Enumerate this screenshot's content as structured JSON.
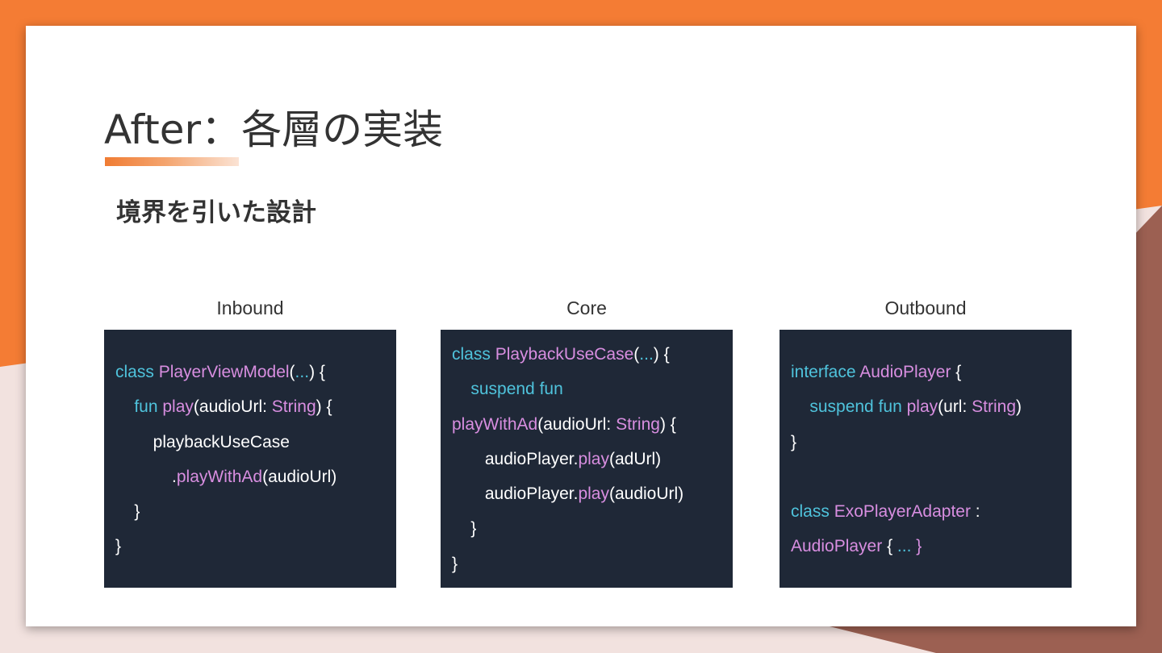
{
  "slide": {
    "title": "After：各層の実装",
    "subtitle": "境界を引いた設計"
  },
  "colors": {
    "accent": "#f07c33",
    "background_dark": "#9c6052",
    "background_light": "#f2e2df",
    "code_background": "#1f2837",
    "keyword": "#4fc3dc",
    "type_or_function": "#d88ee0",
    "plain_code": "#ffffff"
  },
  "columns": [
    {
      "label": "Inbound",
      "lines": [
        [
          {
            "t": "class ",
            "c": "k"
          },
          {
            "t": "PlayerViewModel",
            "c": "t"
          },
          {
            "t": "(",
            "c": "p"
          },
          {
            "t": "...",
            "c": "d"
          },
          {
            "t": ") {",
            "c": "p"
          }
        ],
        [
          {
            "t": "    ",
            "c": "p"
          },
          {
            "t": "fun ",
            "c": "k"
          },
          {
            "t": "play",
            "c": "t"
          },
          {
            "t": "(audioUrl: ",
            "c": "p"
          },
          {
            "t": "String",
            "c": "t"
          },
          {
            "t": ") {",
            "c": "p"
          }
        ],
        [
          {
            "t": "        playbackUseCase",
            "c": "p"
          }
        ],
        [
          {
            "t": "            .",
            "c": "p"
          },
          {
            "t": "playWithAd",
            "c": "t"
          },
          {
            "t": "(audioUrl)",
            "c": "p"
          }
        ],
        [
          {
            "t": "    }",
            "c": "p"
          }
        ],
        [
          {
            "t": "}",
            "c": "p"
          }
        ]
      ]
    },
    {
      "label": "Core",
      "lines": [
        [
          {
            "t": "class ",
            "c": "k"
          },
          {
            "t": "PlaybackUseCase",
            "c": "t"
          },
          {
            "t": "(",
            "c": "p"
          },
          {
            "t": "...",
            "c": "d"
          },
          {
            "t": ") {",
            "c": "p"
          }
        ],
        [
          {
            "t": "    ",
            "c": "p"
          },
          {
            "t": "suspend fun",
            "c": "k"
          }
        ],
        [
          {
            "t": "playWithAd",
            "c": "t"
          },
          {
            "t": "(audioUrl: ",
            "c": "p"
          },
          {
            "t": "String",
            "c": "t"
          },
          {
            "t": ") {",
            "c": "p"
          }
        ],
        [
          {
            "t": "       audioPlayer.",
            "c": "p"
          },
          {
            "t": "play",
            "c": "t"
          },
          {
            "t": "(adUrl)",
            "c": "p"
          }
        ],
        [
          {
            "t": "       audioPlayer.",
            "c": "p"
          },
          {
            "t": "play",
            "c": "t"
          },
          {
            "t": "(audioUrl)",
            "c": "p"
          }
        ],
        [
          {
            "t": "    }",
            "c": "p"
          }
        ],
        [
          {
            "t": "}",
            "c": "p"
          }
        ]
      ]
    },
    {
      "label": "Outbound",
      "lines": [
        [
          {
            "t": "interface ",
            "c": "k"
          },
          {
            "t": "AudioPlayer",
            "c": "t"
          },
          {
            "t": " {",
            "c": "p"
          }
        ],
        [
          {
            "t": "    ",
            "c": "p"
          },
          {
            "t": "suspend fun ",
            "c": "k"
          },
          {
            "t": "play",
            "c": "t"
          },
          {
            "t": "(url: ",
            "c": "p"
          },
          {
            "t": "String",
            "c": "t"
          },
          {
            "t": ")",
            "c": "p"
          }
        ],
        [
          {
            "t": "}",
            "c": "p"
          }
        ],
        [],
        [
          {
            "t": "class ",
            "c": "k"
          },
          {
            "t": "ExoPlayerAdapter",
            "c": "t"
          },
          {
            "t": " :",
            "c": "p"
          }
        ],
        [
          {
            "t": "AudioPlayer",
            "c": "t"
          },
          {
            "t": " { ",
            "c": "p"
          },
          {
            "t": "...",
            "c": "d"
          },
          {
            "t": " }",
            "c": "t"
          }
        ]
      ]
    }
  ]
}
